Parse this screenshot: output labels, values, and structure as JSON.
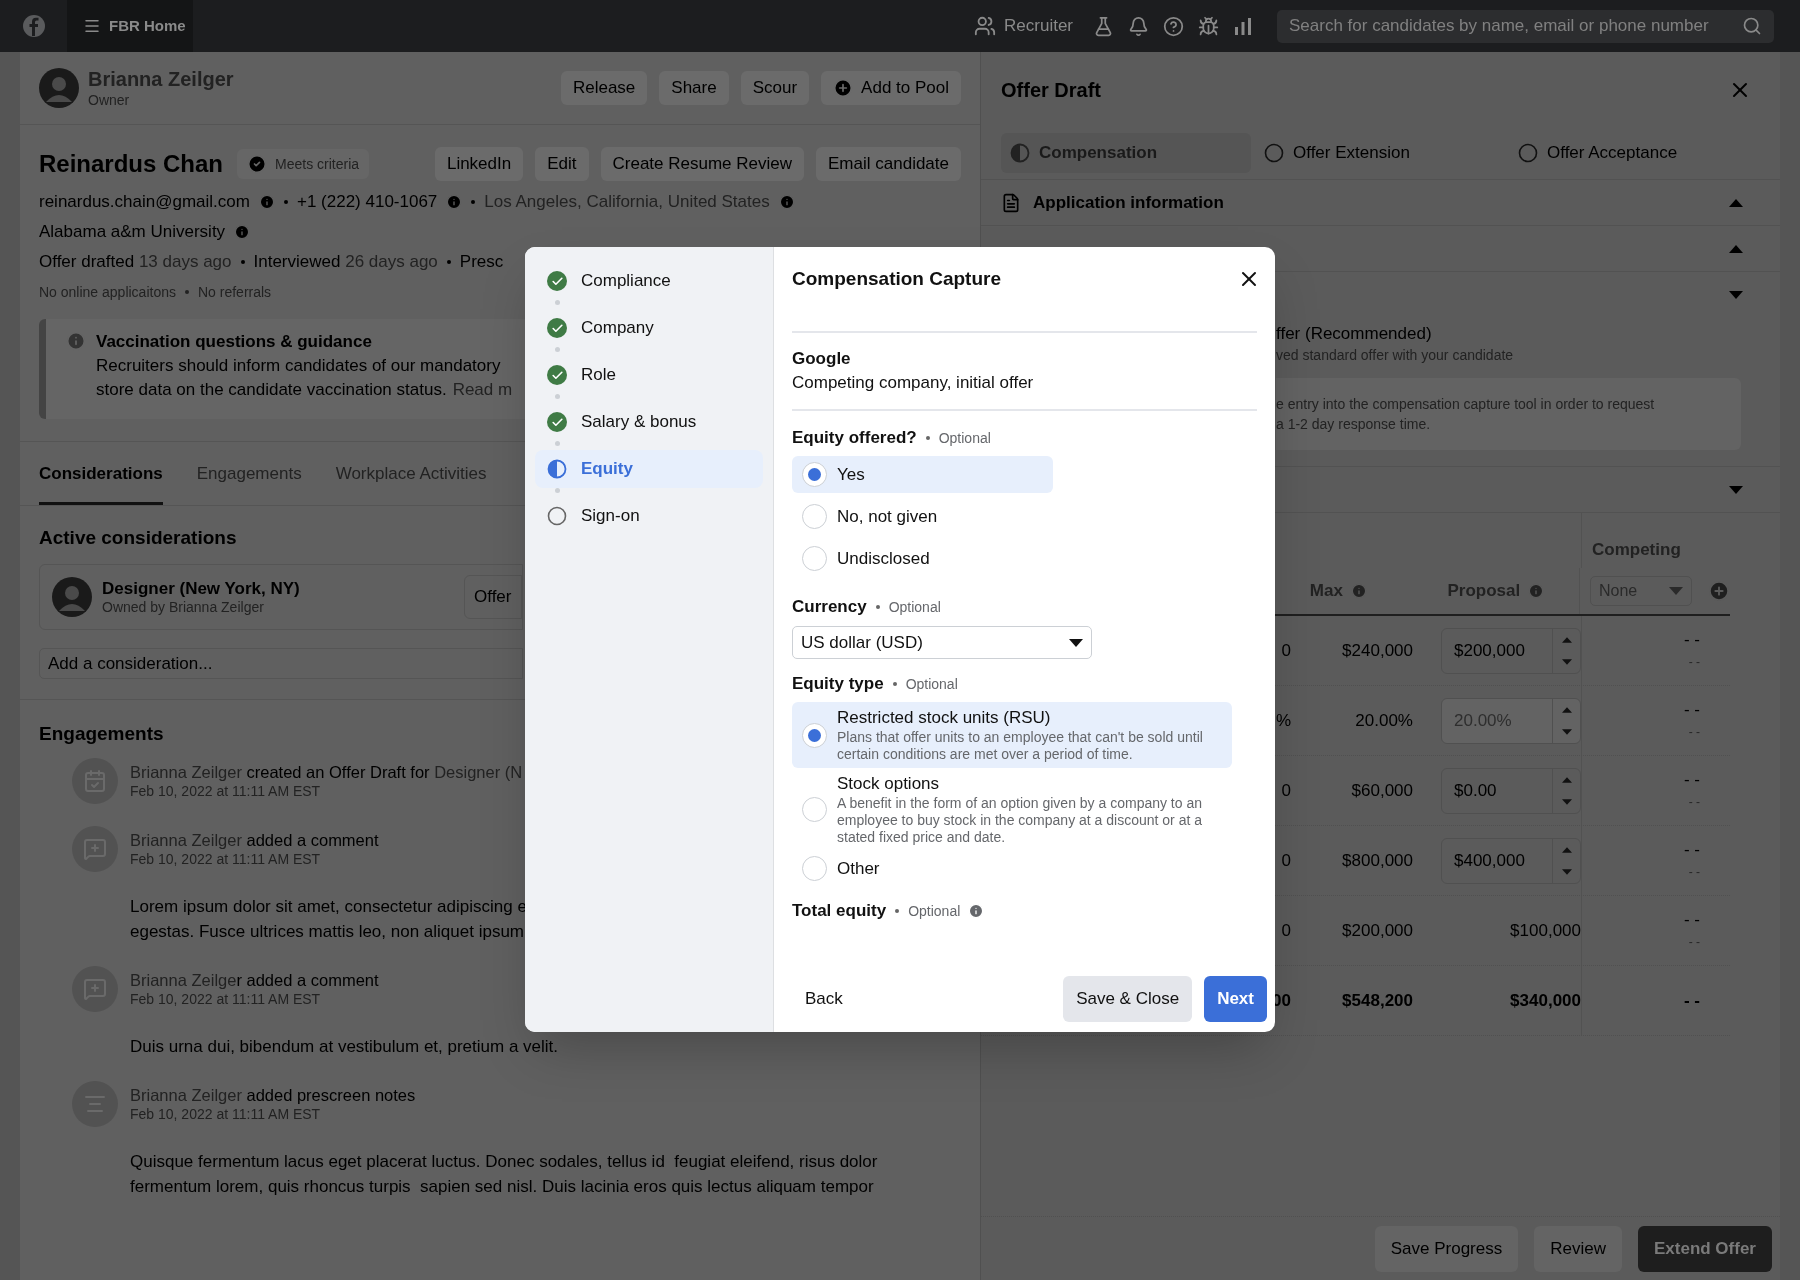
{
  "top_bar": {
    "app_name": "FBR Home",
    "role": "Recruiter",
    "search": {
      "placeholder": "Search for candidates by name, email or phone number"
    }
  },
  "owner": {
    "name": "Brianna Zeilger",
    "role": "Owner",
    "actions": [
      {
        "label": "Release",
        "kind": "plain"
      },
      {
        "label": "Share",
        "kind": "plain"
      },
      {
        "label": "Scour",
        "kind": "plain"
      },
      {
        "label": "Add to Pool",
        "kind": "add"
      }
    ]
  },
  "candidate": {
    "name": "Reinardus Chan",
    "badge": "Meets criteria",
    "actions": [
      "LinkedIn",
      "Edit",
      "Create Resume Review",
      "Email candidate"
    ],
    "contacts": [
      {
        "text": "reinardus.chain@gmail.com",
        "muted": false
      },
      {
        "text": "+1 (222) 410-1067",
        "muted": false
      },
      {
        "text": "Los Angeles, California, United States",
        "muted": true
      }
    ],
    "school": "Alabama a&m University",
    "timeline": [
      {
        "label": "Offer drafted",
        "ago": "13 days ago"
      },
      {
        "label": "Interviewed",
        "ago": "26 days ago"
      },
      {
        "label": "Presc"
      }
    ],
    "stats": [
      "No online applicaitons",
      "No referrals"
    ]
  },
  "notice": {
    "title": "Vaccination questions & guidance",
    "lines": [
      "Recruiters should inform candidates of our mandatory",
      "store data on the candidate vaccination status."
    ],
    "link": "Read m"
  },
  "tabs": [
    {
      "label": "Considerations",
      "selected": true
    },
    {
      "label": "Engagements",
      "selected": false
    },
    {
      "label": "Workplace Activities",
      "selected": false
    }
  ],
  "considerations": {
    "title": "Active considerations",
    "items": [
      {
        "role": "Designer (New York, NY)",
        "owner": "Owned by Brianna Zeilger",
        "action": "Offer"
      }
    ],
    "add_placeholder": "Add a consideration..."
  },
  "engagements": {
    "title": "Engagements",
    "items": [
      {
        "kind": "offer",
        "actor": "Brianna Zeilger",
        "action": " created an Offer Draft for ",
        "target": "Designer (N",
        "time": "Feb 10, 2022 at 11:11 AM EST"
      },
      {
        "kind": "comment",
        "actor": "Brianna Zeilger",
        "action": " added a comment",
        "time": "Feb 10, 2022 at 11:11 AM EST",
        "body": [
          "Lorem ipsum dolor sit amet, consectetur adipiscing e",
          "egestas. Fusce ultrices mattis leo, non aliquet ipsum"
        ]
      },
      {
        "kind": "comment",
        "actor": "Brianna Zeilge",
        "action": "r added a comment",
        "time": "Feb 10, 2022 at 11:11 AM EST",
        "body": [
          "Duis urna dui, bibendum at vestibulum et, pretium a velit."
        ]
      },
      {
        "kind": "notes",
        "actor": "Brianna Zeilger",
        "action": " added prescreen notes",
        "time": "Feb 10, 2022 at 11:11 AM EST",
        "body": [
          "Quisque fermentum lacus eget placerat luctus. Donec sodales, tellus id  feugiat eleifend, risus dolor",
          "fermentum lorem, quis rhoncus turpis  sapien sed nisl. Duis lacinia eros quis lectus aliquam tempor"
        ]
      }
    ]
  },
  "offer_panel": {
    "title": "Offer Draft",
    "steps": [
      {
        "label": "Compensation",
        "kind": "in_progress",
        "selected": true
      },
      {
        "label": "Offer Extension",
        "kind": "not_started",
        "selected": false
      },
      {
        "label": "Offer Acceptance",
        "kind": "not_started",
        "selected": false
      }
    ],
    "sections": [
      {
        "title": "Application information",
        "expanded": true
      },
      {
        "expanded": true
      },
      {
        "expanded": false,
        "option": {
          "title": "ffer (Recommended)",
          "subtitle": "ved standard offer with your candidate"
        },
        "note": [
          "e entry into the compensation capture tool in order to request",
          "a 1-2 day response time."
        ]
      },
      {
        "expanded": false
      }
    ],
    "table": {
      "group_header": "Competing",
      "columns": [
        "Max",
        "Proposal"
      ],
      "competing_select": "None",
      "rows": [
        {
          "cut": "0",
          "max": "$240,000",
          "proposal": {
            "kind": "input",
            "value": "$200,000",
            "disabled": false
          },
          "competing": [
            "- -",
            "- -"
          ],
          "total": false
        },
        {
          "cut": "%",
          "max": "20.00%",
          "proposal": {
            "kind": "input",
            "value": "20.00%",
            "disabled": true
          },
          "competing": [
            "- -",
            "- -"
          ],
          "total": false
        },
        {
          "cut": "0",
          "max": "$60,000",
          "proposal": {
            "kind": "input",
            "value": "$0.00",
            "disabled": false
          },
          "competing": [
            "- -",
            "- -"
          ],
          "total": false
        },
        {
          "cut": "0",
          "max": "$800,000",
          "proposal": {
            "kind": "input",
            "value": "$400,000",
            "disabled": false
          },
          "competing": [
            "- -",
            "- -"
          ],
          "total": false
        },
        {
          "cut": "0",
          "max": "$200,000",
          "proposal": {
            "kind": "text",
            "value": "$100,000"
          },
          "competing": [
            "- -",
            "- -"
          ],
          "total": false
        },
        {
          "cut": "00",
          "max": "$548,200",
          "proposal": {
            "kind": "text",
            "value": "$340,000"
          },
          "competing": [
            "- -"
          ],
          "total": true
        }
      ]
    },
    "footer": [
      {
        "label": "Save Progress",
        "kind": "secondary"
      },
      {
        "label": "Review",
        "kind": "secondary"
      },
      {
        "label": "Extend Offer",
        "kind": "primary"
      }
    ]
  },
  "modal": {
    "title": "Compensation Capture",
    "steps": [
      {
        "label": "Compliance",
        "kind": "done",
        "selected": false
      },
      {
        "label": "Company",
        "kind": "done",
        "selected": false
      },
      {
        "label": "Role",
        "kind": "done",
        "selected": false
      },
      {
        "label": "Salary & bonus",
        "kind": "done",
        "selected": false
      },
      {
        "label": "Equity",
        "kind": "in_progress",
        "selected": true
      },
      {
        "label": "Sign-on",
        "kind": "not_started",
        "selected": false
      }
    ],
    "company": {
      "name": "Google",
      "detail": "Competing company, initial offer"
    },
    "fields": [
      {
        "kind": "radio",
        "label": "Equity offered?",
        "hint": "Optional",
        "options": [
          {
            "label": "Yes",
            "selected": true
          },
          {
            "label": "No, not given",
            "selected": false
          },
          {
            "label": "Undisclosed",
            "selected": false
          }
        ]
      },
      {
        "kind": "select",
        "label": "Currency",
        "hint": "Optional",
        "value": "US dollar (USD)"
      },
      {
        "kind": "radio",
        "label": "Equity type",
        "hint": "Optional",
        "options": [
          {
            "label": "Restricted stock units (RSU)",
            "description": "Plans that offer units to an employee that can't be sold until certain conditions are met over a period of time.",
            "selected": true
          },
          {
            "label": "Stock options",
            "description": "A benefit in the form of an option given by a company to an employee to buy stock in the company at a discount or at a stated fixed price and date.",
            "selected": false
          },
          {
            "label": "Other",
            "selected": false
          }
        ]
      },
      {
        "kind": "header",
        "label": "Total equity",
        "hint": "Optional",
        "info": true
      }
    ],
    "actions": [
      {
        "label": "Back",
        "kind": "text"
      },
      {
        "label": "Save & Close",
        "kind": "secondary"
      },
      {
        "label": "Next",
        "kind": "primary"
      }
    ]
  }
}
